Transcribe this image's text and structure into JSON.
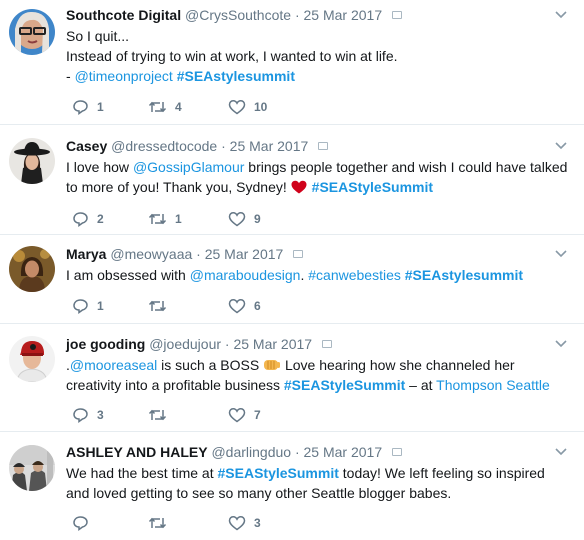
{
  "tweets": [
    {
      "name": "Southcote Digital",
      "handle": "@CrysSouthcote",
      "date": "· 25 Mar 2017",
      "lines": {
        "l1": "So I quit...",
        "l2": "Instead of trying to win at work, I wanted to win at life.",
        "l3_a": "- ",
        "l3_link": "@timeonproject",
        "l3_sp": " ",
        "l3_tag": "#SEAstylesummit"
      },
      "replies": "1",
      "retweets": "4",
      "likes": "10"
    },
    {
      "name": "Casey",
      "handle": "@dressedtocode",
      "date": "· 25 Mar 2017",
      "lines": {
        "l1_a": "I love how ",
        "l1_link": "@GossipGlamour",
        "l1_b": " brings people together and wish I could have talked",
        "l2_a": "to more of you! Thank you, Sydney! ",
        "l2_tag": "#SEAStyleSummit"
      },
      "replies": "2",
      "retweets": "1",
      "likes": "9"
    },
    {
      "name": "Marya",
      "handle": "@meowyaaa",
      "date": "· 25 Mar 2017",
      "lines": {
        "l1_a": "I am obsessed with ",
        "l1_link": "@maraboudesign",
        "l1_b": ". ",
        "l1_link2": "#canwebesties",
        "l1_sp": " ",
        "l1_tag": "#SEAstylesummit"
      },
      "replies": "1",
      "retweets": "",
      "likes": "6"
    },
    {
      "name": "joe gooding",
      "handle": "@joedujour",
      "date": "· 25 Mar 2017",
      "lines": {
        "l1_a": ".",
        "l1_link": "@mooreaseal",
        "l1_b": " is such a BOSS ",
        "l1_c": " Love hearing how she channeled her",
        "l2_a": "creativity into a profitable business ",
        "l2_tag": "#SEAStyleSummit",
        "l2_b": " – at ",
        "l2_link": "Thompson Seattle"
      },
      "replies": "3",
      "retweets": "",
      "likes": "7"
    },
    {
      "name": "ASHLEY AND HALEY",
      "handle": "@darlingduo",
      "date": "· 25 Mar 2017",
      "lines": {
        "l1_a": "We had the best time at ",
        "l1_tag": "#SEAStyleSummit",
        "l1_b": " today! We left feeling so inspired",
        "l2": "and loved getting to see so many other Seattle blogger babes."
      },
      "replies": "",
      "retweets": "",
      "likes": "3"
    }
  ],
  "icons": {
    "reply": "reply-icon",
    "retweet": "retweet-icon",
    "like": "heart-icon",
    "menu": "chevron-down-icon",
    "dm": "message-icon"
  },
  "colors": {
    "link": "#1b95e0",
    "text": "#14171a",
    "muted": "#657786",
    "heart": "#e0245e"
  }
}
